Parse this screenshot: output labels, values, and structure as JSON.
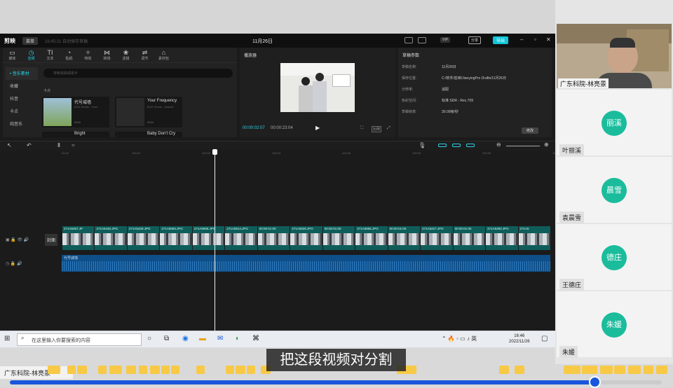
{
  "editor": {
    "logo": "剪映",
    "menu_label": "菜单",
    "autosave": "16:45:21 自动保存草稿",
    "project_title": "11月26日",
    "vip_label": "VIP",
    "share_label": "分享",
    "export_label": "导出",
    "tools": [
      {
        "label": "媒体",
        "icon": "▭"
      },
      {
        "label": "音频",
        "icon": "◷"
      },
      {
        "label": "文本",
        "icon": "TI"
      },
      {
        "label": "贴纸",
        "icon": "◔"
      },
      {
        "label": "特效",
        "icon": "✧"
      },
      {
        "label": "转场",
        "icon": "⋈"
      },
      {
        "label": "滤镜",
        "icon": "❀"
      },
      {
        "label": "调节",
        "icon": "⇌"
      },
      {
        "label": "素材包",
        "icon": "⌂"
      }
    ],
    "left_nav": [
      "• 音乐素材",
      "收藏",
      "抖音",
      "卡点",
      "纯音乐"
    ],
    "search_placeholder": "搜索歌曲或歌手",
    "fav_label": "卡点",
    "music_cards": [
      {
        "title": "代号城墙",
        "artist": "BCD Studio - Over",
        "duration": "0015"
      },
      {
        "title": "Your Frequency",
        "artist": "BCD Studio - Natural",
        "duration": "0024"
      },
      {
        "title": "Bright",
        "artist": "",
        "duration": ""
      },
      {
        "title": "Baby Don't Cry",
        "artist": "",
        "duration": ""
      }
    ],
    "player": {
      "title": "播放器",
      "current": "00:00:02:07",
      "total": "00:00:23:04",
      "ratio": "比例"
    },
    "draft": {
      "title": "草稿参数",
      "rows": [
        {
          "k": "草稿名称:",
          "v": "11月26日"
        },
        {
          "k": "保存位置:",
          "v": "C:/软件/剪映/JianyingPro Drafts/11月26日"
        },
        {
          "k": "分辨率:",
          "v": "适配"
        },
        {
          "k": "色彩空间:",
          "v": "标准 SDR - Rec.709"
        },
        {
          "k": "草稿帧率:",
          "v": "30.00帧/秒"
        }
      ],
      "modify": "修改"
    },
    "ruler": [
      "00:00",
      "100:01",
      "100:02",
      "100:03",
      "100:04",
      "100:05",
      "100:06",
      "100:07",
      "1:00"
    ],
    "cover_label": "封面",
    "video_clips": [
      "271A5457.JP",
      "271A5445.JPG",
      "271A5428.JPG",
      "271A5083.JPG",
      "271A5908.JPG",
      "271A5914.JPG",
      "00:00:01:00",
      "271A5828.JPG",
      "00:00:01:00",
      "271A5855.JPG",
      "00:00:01:00",
      "271A5427.JPG",
      "00:00:01:00",
      "271A5393.JPG",
      "271A5"
    ],
    "audio_label": "代号城墙"
  },
  "taskbar": {
    "search_placeholder": "在这里输入你要搜索的内容",
    "time": "16:46",
    "date": "2022/11/26",
    "lang": "英"
  },
  "subtitle": "把这段视频对分割",
  "meeting": {
    "host_label": "广东科院-林亮景",
    "participants": [
      {
        "avatar": "丽溪",
        "name": "叶丽溪"
      },
      {
        "avatar": "晨雪",
        "name": "袁晨雪"
      },
      {
        "avatar": "德庄",
        "name": "王德庄"
      },
      {
        "avatar": "朱媛",
        "name": "朱媛"
      }
    ],
    "camera_label": "广东科院-林亮景"
  },
  "colors": {
    "accent": "#2ad3e6",
    "avatar": "#1abc9c",
    "progress": "#1a56db"
  }
}
